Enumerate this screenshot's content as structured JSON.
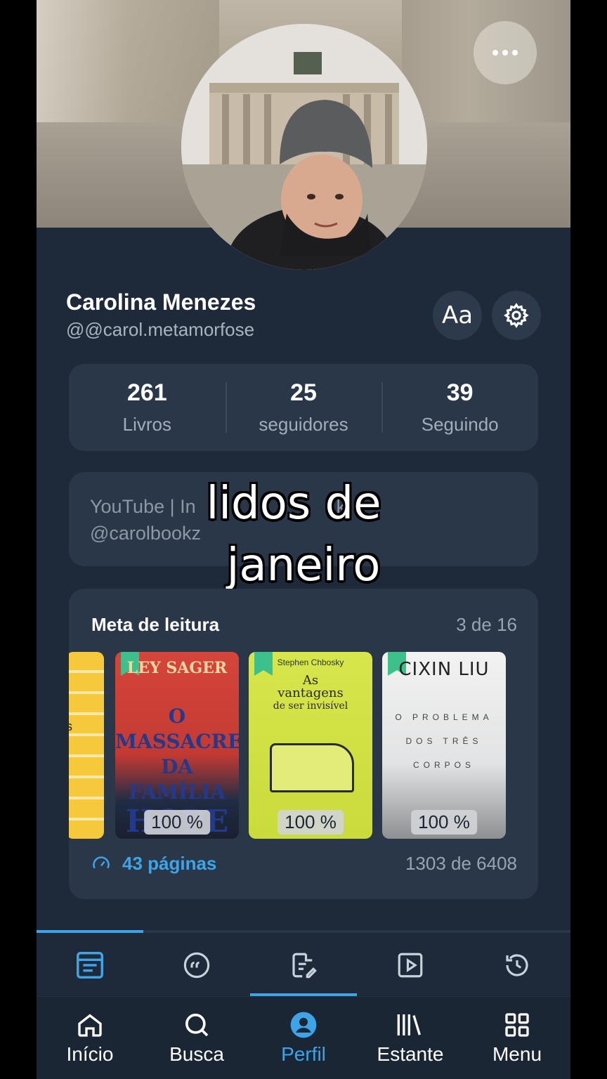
{
  "profile": {
    "name": "Carolina Menezes",
    "handle": "@@carol.metamorfose",
    "font_button_label": "Aa"
  },
  "stats": [
    {
      "value": "261",
      "label": "Livros"
    },
    {
      "value": "25",
      "label": "seguidores"
    },
    {
      "value": "39",
      "label": "Seguindo"
    }
  ],
  "bio": {
    "line1": "YouTube | In",
    "line1_tail": "k",
    "line2": "@carolbookz"
  },
  "overlay_caption": {
    "line1": "lidos de",
    "line2": "janeiro"
  },
  "reading_goal": {
    "title": "Meta de leitura",
    "count": "3 de 16",
    "books": [
      {
        "author": "",
        "title": "",
        "progress": "",
        "cut_letter": "s"
      },
      {
        "author": "LEY SAGER",
        "title_lines": [
          "O",
          "MASSACRE",
          "DA FAMÍLIA",
          "HOPE"
        ],
        "progress": "100 %"
      },
      {
        "author": "Stephen Chbosky",
        "title_lines": [
          "As",
          "vantagens",
          "de ser invisível"
        ],
        "progress": "100 %"
      },
      {
        "author": "CIXIN LIU",
        "title_lines": [
          "O PROBLEMA",
          "DOS TRÊS",
          "CORPOS"
        ],
        "progress": "100 %"
      }
    ],
    "pages_label": "43 páginas",
    "pages_total": "1303 de 6408"
  },
  "tabs": {
    "icons": [
      "feed-icon",
      "quote-icon",
      "review-icon",
      "video-icon",
      "history-icon"
    ],
    "active_index": 2
  },
  "bottom_nav": [
    {
      "label": "Início",
      "icon": "home-icon"
    },
    {
      "label": "Busca",
      "icon": "search-icon"
    },
    {
      "label": "Perfil",
      "icon": "profile-icon"
    },
    {
      "label": "Estante",
      "icon": "bookshelf-icon"
    },
    {
      "label": "Menu",
      "icon": "grid-menu-icon"
    }
  ],
  "colors": {
    "accent": "#3ea4e8",
    "background": "#1e2a3a",
    "card": "#2a3749",
    "ribbon": "#3ec08d"
  }
}
